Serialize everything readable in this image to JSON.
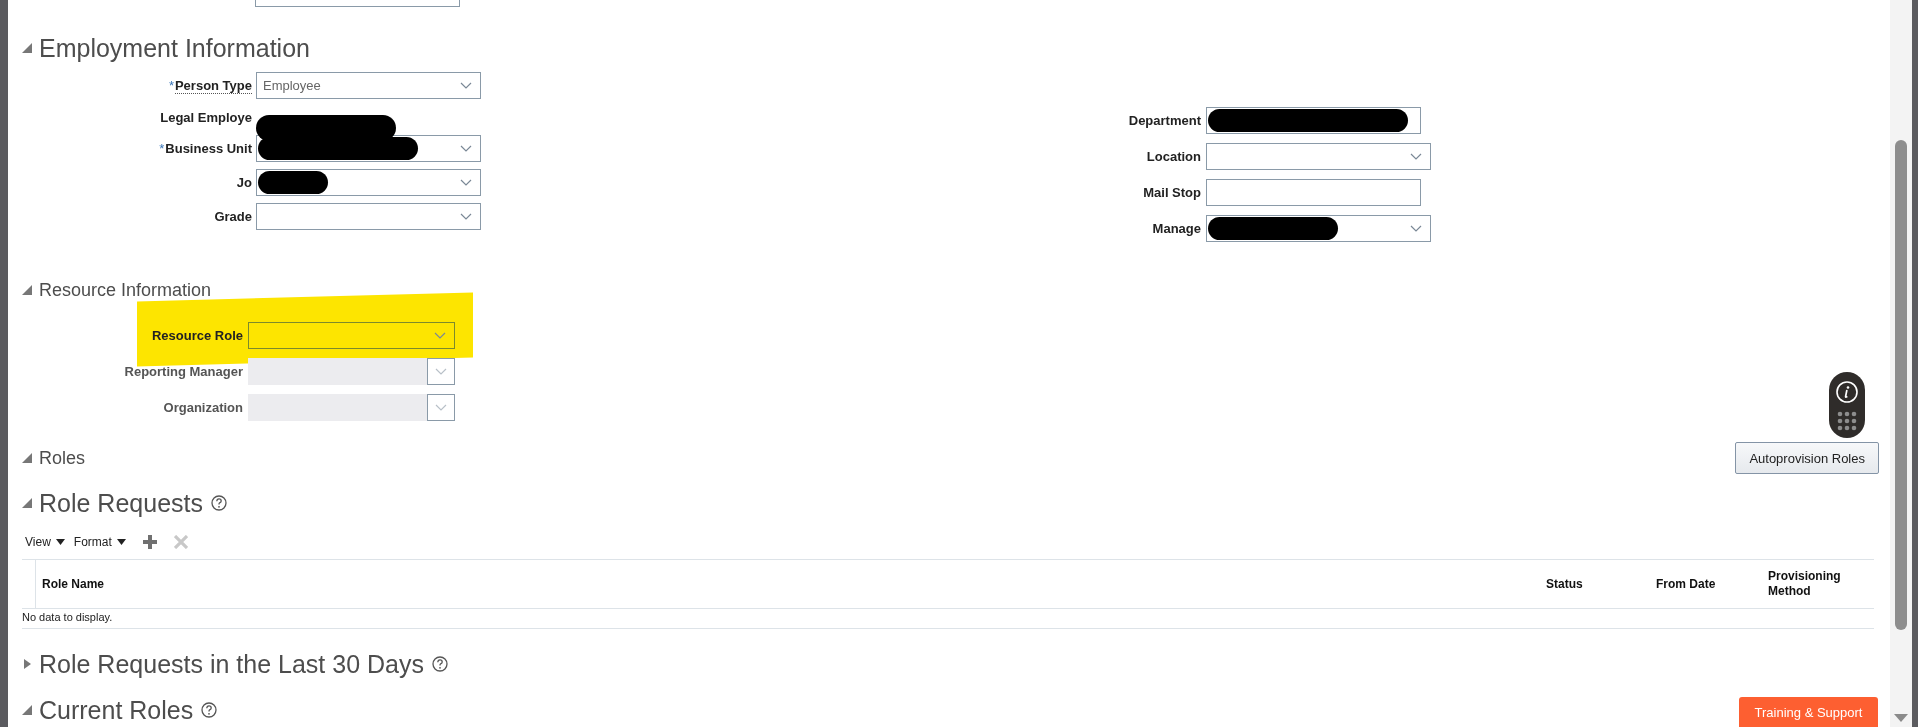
{
  "partial_field": {
    "kind": "text"
  },
  "sections": [
    {
      "kind": "employment",
      "title": "Employment Information",
      "expanded": true,
      "left_fields": [
        {
          "label": "Person Type",
          "required_mark": "*",
          "has_help": true,
          "kind": "select",
          "value": "Employee",
          "redacted": false
        },
        {
          "label": "Legal Employe",
          "kind": "display",
          "redacted": true
        },
        {
          "label": "Business Unit",
          "required_mark": "*",
          "kind": "select",
          "redacted": true
        },
        {
          "label": "Jo",
          "kind": "select",
          "redacted": true
        },
        {
          "label": "Grade",
          "kind": "select",
          "redacted": false
        }
      ],
      "right_fields": [
        {
          "label": "Department",
          "kind": "text",
          "redacted": true
        },
        {
          "label": "Location",
          "kind": "select",
          "redacted": false
        },
        {
          "label": "Mail Stop",
          "kind": "text",
          "redacted": false
        },
        {
          "label": "Manage",
          "kind": "select",
          "redacted": true
        }
      ]
    },
    {
      "kind": "resource",
      "title": "Resource Information",
      "expanded": true,
      "fields": [
        {
          "label": "Resource Role",
          "kind": "select",
          "disabled": false,
          "highlighted": true
        },
        {
          "label": "Reporting Manager",
          "kind": "select",
          "disabled": true,
          "highlighted": false
        },
        {
          "label": "Organization",
          "kind": "select",
          "disabled": true,
          "highlighted": false
        }
      ]
    },
    {
      "kind": "roles",
      "title": "Roles",
      "expanded": true,
      "button": "Autoprovision Roles"
    },
    {
      "kind": "table",
      "title": "Role Requests",
      "expanded": true,
      "help": true,
      "toolbar": [
        {
          "kind": "menu",
          "label": "View"
        },
        {
          "kind": "menu",
          "label": "Format"
        },
        {
          "kind": "add",
          "disabled": false
        },
        {
          "kind": "delete",
          "disabled": true
        }
      ],
      "columns": [
        "Role Name",
        "Status",
        "From Date",
        "Provisioning Method"
      ],
      "empty_text": "No data to display."
    },
    {
      "kind": "header",
      "title": "Role Requests in the Last 30 Days",
      "expanded": false,
      "help": true
    },
    {
      "kind": "header",
      "title": "Current Roles",
      "expanded": true,
      "help": true
    }
  ],
  "training_button": "Training & Support"
}
